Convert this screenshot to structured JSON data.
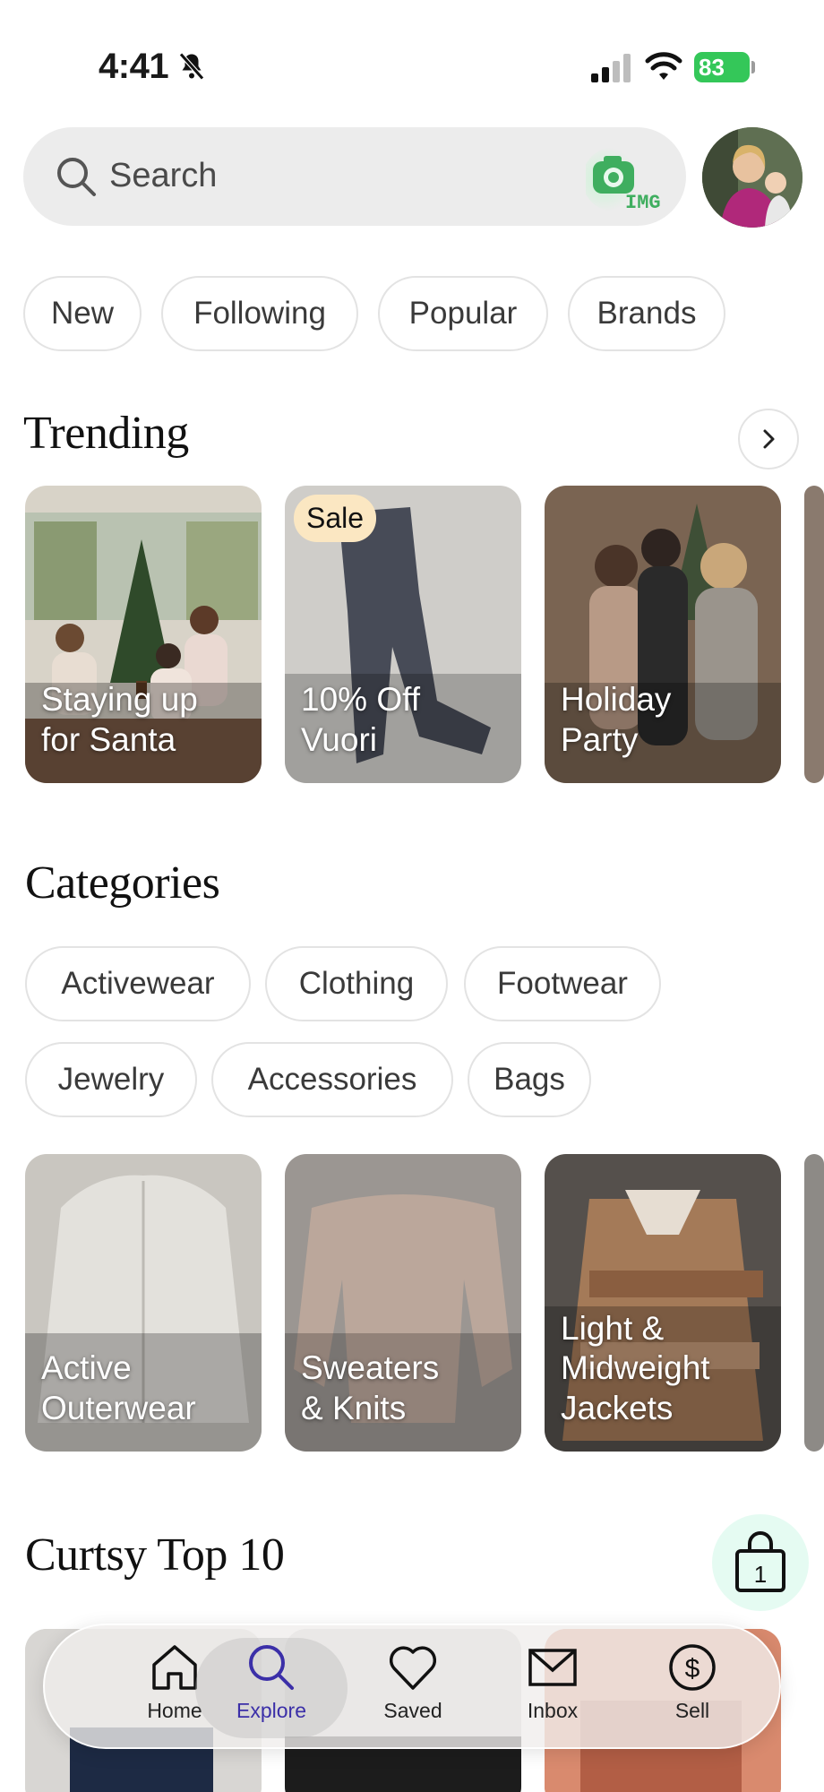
{
  "status": {
    "time": "4:41",
    "battery": "83"
  },
  "search": {
    "placeholder": "Search",
    "img_label": "IMG"
  },
  "feed_tabs": [
    "New",
    "Following",
    "Popular",
    "Brands"
  ],
  "trending": {
    "title": "Trending",
    "cards": [
      {
        "line1": "Staying up",
        "line2": "for Santa"
      },
      {
        "line1": "10% Off",
        "line2": "Vuori",
        "badge": "Sale"
      },
      {
        "line1": "Holiday",
        "line2": "Party"
      }
    ]
  },
  "categories": {
    "title": "Categories",
    "chips": [
      "Activewear",
      "Clothing",
      "Footwear",
      "Jewelry",
      "Accessories",
      "Bags"
    ],
    "cards": [
      {
        "lines": [
          "Active",
          "Outerwear"
        ]
      },
      {
        "lines": [
          "Sweaters",
          "& Knits"
        ]
      },
      {
        "lines": [
          "Light &",
          "Midweight",
          "Jackets"
        ]
      }
    ]
  },
  "top10": {
    "title": "Curtsy Top 10"
  },
  "cart": {
    "count": "1"
  },
  "nav": {
    "items": [
      {
        "label": "Home",
        "icon": "home-icon"
      },
      {
        "label": "Explore",
        "icon": "search-icon",
        "active": true
      },
      {
        "label": "Saved",
        "icon": "heart-icon"
      },
      {
        "label": "Inbox",
        "icon": "mail-icon"
      },
      {
        "label": "Sell",
        "icon": "dollar-icon"
      }
    ]
  },
  "colors": {
    "accent_green": "#34c759",
    "active_tab": "#3b2fa8",
    "sale_badge": "#fbe7c2"
  }
}
